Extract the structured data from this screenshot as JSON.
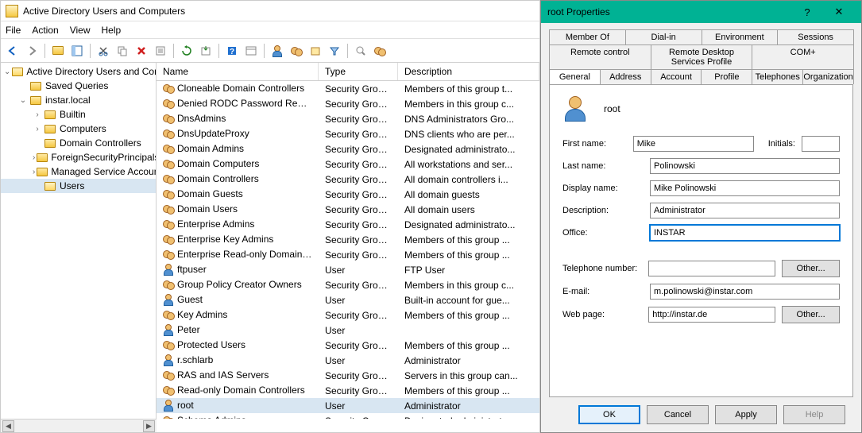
{
  "main_window": {
    "title": "Active Directory Users and Computers",
    "menu": [
      "File",
      "Action",
      "View",
      "Help"
    ],
    "tree": {
      "root": "Active Directory Users and Com",
      "nodes": [
        {
          "label": "Saved Queries",
          "indent": 1,
          "exp": "",
          "icon": "folder"
        },
        {
          "label": "instar.local",
          "indent": 1,
          "exp": "⌄",
          "icon": "folder"
        },
        {
          "label": "Builtin",
          "indent": 2,
          "exp": "›",
          "icon": "folder"
        },
        {
          "label": "Computers",
          "indent": 2,
          "exp": "›",
          "icon": "folder"
        },
        {
          "label": "Domain Controllers",
          "indent": 2,
          "exp": "",
          "icon": "folder"
        },
        {
          "label": "ForeignSecurityPrincipals",
          "indent": 2,
          "exp": "›",
          "icon": "folder"
        },
        {
          "label": "Managed Service Accoun",
          "indent": 2,
          "exp": "›",
          "icon": "folder"
        },
        {
          "label": "Users",
          "indent": 2,
          "exp": "",
          "icon": "folder",
          "selected": true
        }
      ]
    },
    "list": {
      "columns": [
        "Name",
        "Type",
        "Description"
      ],
      "rows": [
        {
          "icon": "group",
          "name": "Cloneable Domain Controllers",
          "type": "Security Group...",
          "desc": "Members of this group t..."
        },
        {
          "icon": "group",
          "name": "Denied RODC Password Replicati...",
          "type": "Security Group...",
          "desc": "Members in this group c..."
        },
        {
          "icon": "group",
          "name": "DnsAdmins",
          "type": "Security Group...",
          "desc": "DNS Administrators Gro..."
        },
        {
          "icon": "group",
          "name": "DnsUpdateProxy",
          "type": "Security Group...",
          "desc": "DNS clients who are per..."
        },
        {
          "icon": "group",
          "name": "Domain Admins",
          "type": "Security Group...",
          "desc": "Designated administrato..."
        },
        {
          "icon": "group",
          "name": "Domain Computers",
          "type": "Security Group...",
          "desc": "All workstations and ser..."
        },
        {
          "icon": "group",
          "name": "Domain Controllers",
          "type": "Security Group...",
          "desc": "All domain controllers i..."
        },
        {
          "icon": "group",
          "name": "Domain Guests",
          "type": "Security Group...",
          "desc": "All domain guests"
        },
        {
          "icon": "group",
          "name": "Domain Users",
          "type": "Security Group...",
          "desc": "All domain users"
        },
        {
          "icon": "group",
          "name": "Enterprise Admins",
          "type": "Security Group...",
          "desc": "Designated administrato..."
        },
        {
          "icon": "group",
          "name": "Enterprise Key Admins",
          "type": "Security Group...",
          "desc": "Members of this group ..."
        },
        {
          "icon": "group",
          "name": "Enterprise Read-only Domain Co...",
          "type": "Security Group...",
          "desc": "Members of this group ..."
        },
        {
          "icon": "user",
          "name": "ftpuser",
          "type": "User",
          "desc": "FTP User"
        },
        {
          "icon": "group",
          "name": "Group Policy Creator Owners",
          "type": "Security Group...",
          "desc": "Members in this group c..."
        },
        {
          "icon": "user",
          "name": "Guest",
          "type": "User",
          "desc": "Built-in account for gue..."
        },
        {
          "icon": "group",
          "name": "Key Admins",
          "type": "Security Group...",
          "desc": "Members of this group ..."
        },
        {
          "icon": "user",
          "name": "Peter",
          "type": "User",
          "desc": ""
        },
        {
          "icon": "group",
          "name": "Protected Users",
          "type": "Security Group...",
          "desc": "Members of this group ..."
        },
        {
          "icon": "user",
          "name": "r.schlarb",
          "type": "User",
          "desc": "Administrator"
        },
        {
          "icon": "group",
          "name": "RAS and IAS Servers",
          "type": "Security Group...",
          "desc": "Servers in this group can..."
        },
        {
          "icon": "group",
          "name": "Read-only Domain Controllers",
          "type": "Security Group...",
          "desc": "Members of this group ..."
        },
        {
          "icon": "user",
          "name": "root",
          "type": "User",
          "desc": "Administrator",
          "selected": true
        },
        {
          "icon": "group",
          "name": "Schema Admins",
          "type": "Security Group...",
          "desc": "Designated administrato..."
        }
      ]
    }
  },
  "dialog": {
    "title": "root Properties",
    "help_glyph": "?",
    "close_glyph": "✕",
    "tabs_row1": [
      "Member Of",
      "Dial-in",
      "Environment",
      "Sessions"
    ],
    "tabs_row2": [
      "Remote control",
      "Remote Desktop Services Profile",
      "COM+"
    ],
    "tabs_row3": [
      "General",
      "Address",
      "Account",
      "Profile",
      "Telephones",
      "Organization"
    ],
    "active_tab": "General",
    "username": "root",
    "fields": {
      "first_name_label": "First name:",
      "first_name": "Mike",
      "initials_label": "Initials:",
      "initials": "",
      "last_name_label": "Last name:",
      "last_name": "Polinowski",
      "display_name_label": "Display name:",
      "display_name": "Mike Polinowski",
      "description_label": "Description:",
      "description": "Administrator",
      "office_label": "Office:",
      "office": "INSTAR",
      "telephone_label": "Telephone number:",
      "telephone": "",
      "email_label": "E-mail:",
      "email": "m.polinowski@instar.com",
      "webpage_label": "Web page:",
      "webpage": "http://instar.de",
      "other_btn": "Other..."
    },
    "buttons": {
      "ok": "OK",
      "cancel": "Cancel",
      "apply": "Apply",
      "help": "Help"
    }
  }
}
